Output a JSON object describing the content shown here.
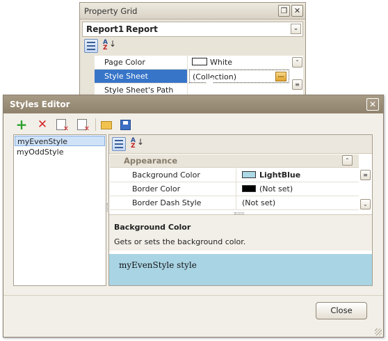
{
  "property_grid": {
    "title": "Property Grid",
    "object_name": "Report1",
    "object_type": "Report",
    "rows": [
      {
        "name": "Page Color",
        "value": "White",
        "swatch": "#ffffff"
      },
      {
        "name": "Style Sheet",
        "value": "(Collection)"
      },
      {
        "name": "Style Sheet's Path",
        "value": ""
      }
    ],
    "ellipsis_label": "..."
  },
  "styles_editor": {
    "title": "Styles Editor",
    "toolbar": [
      "add-icon",
      "delete-icon",
      "purge-icon",
      "clear-icon",
      "open-folder-icon",
      "save-icon"
    ],
    "styles": [
      "myEvenStyle",
      "myOddStyle"
    ],
    "category": "Appearance",
    "props": [
      {
        "name": "Background Color",
        "value": "LightBlue",
        "swatch": "#add8e6",
        "bold": true
      },
      {
        "name": "Border Color",
        "value": "(Not set)",
        "swatch": "#000000"
      },
      {
        "name": "Border Dash Style",
        "value": "(Not set)"
      }
    ],
    "description_title": "Background Color",
    "description_text": "Gets or sets the background color.",
    "preview_text": "myEvenStyle style",
    "close_label": "Close"
  },
  "colors": {
    "selection": "#3775c8",
    "preview_bg": "#a9d4e4",
    "titlebar": "#9a8d77"
  }
}
